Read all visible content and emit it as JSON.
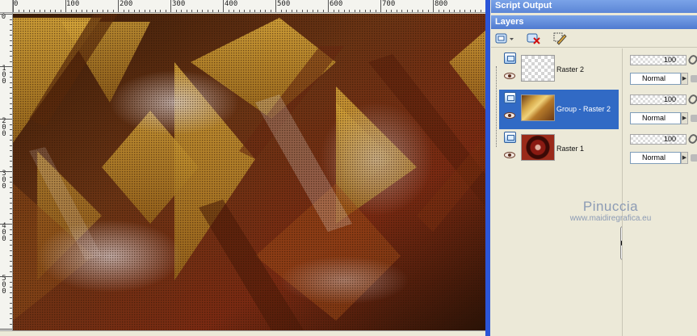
{
  "ruler": {
    "top_labels": [
      "0",
      "100",
      "200",
      "300",
      "400",
      "500",
      "600",
      "700",
      "800"
    ],
    "left_labels": [
      "0",
      "100",
      "200",
      "300",
      "400",
      "500"
    ]
  },
  "panels": {
    "script_output": "Script Output",
    "layers": "Layers"
  },
  "layers": [
    {
      "name": "Raster 2",
      "opacity": "100",
      "blend": "Normal",
      "selected": false,
      "thumb": "transparent-checker"
    },
    {
      "name": "Group  - Raster 2",
      "opacity": "100",
      "blend": "Normal",
      "selected": true,
      "thumb": "gold-pattern"
    },
    {
      "name": "Raster 1",
      "opacity": "100",
      "blend": "Normal",
      "selected": false,
      "thumb": "red-circles"
    }
  ],
  "watermark": {
    "line1": "Pinuccia",
    "line2": "www.maidiregrafica.eu"
  },
  "colors": {
    "title_bar": "#5c86d6",
    "selection": "#316ac5",
    "canvas_gold": "#c9952a",
    "canvas_brown": "#5a2a10"
  },
  "icons": {
    "new_layer": "new-layer-icon",
    "delete_layer": "delete-layer-icon",
    "edit": "edit-icon"
  }
}
